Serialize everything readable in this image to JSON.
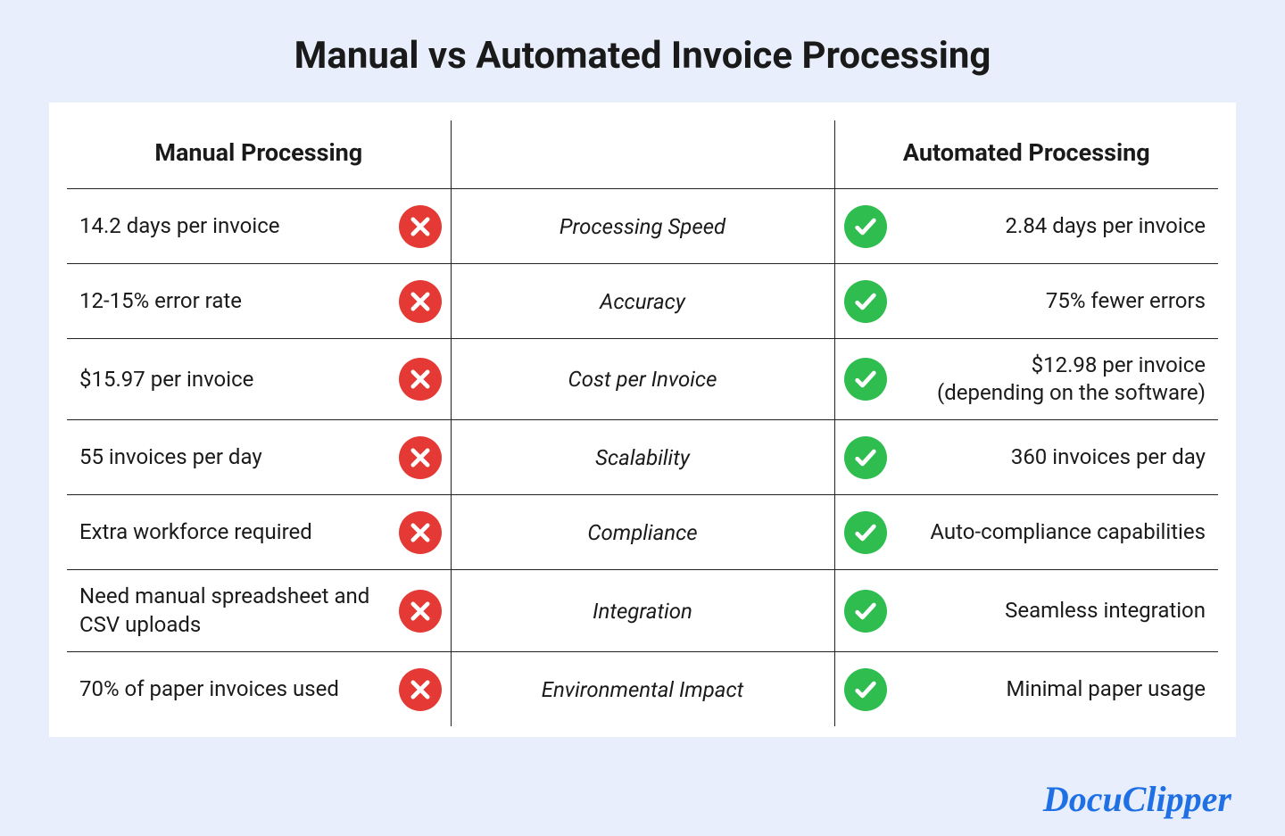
{
  "title": "Manual vs Automated Invoice Processing",
  "headers": {
    "left": "Manual Processing",
    "mid": "",
    "right": "Automated Processing"
  },
  "rows": [
    {
      "manual": "14.2 days per invoice",
      "criterion": "Processing Speed",
      "automated": "2.84 days per invoice"
    },
    {
      "manual": "12-15% error rate",
      "criterion": "Accuracy",
      "automated": "75% fewer errors"
    },
    {
      "manual": "$15.97 per invoice",
      "criterion": "Cost per Invoice",
      "automated": "$12.98 per invoice\n(depending on the software)"
    },
    {
      "manual": "55 invoices per day",
      "criterion": "Scalability",
      "automated": "360 invoices per day"
    },
    {
      "manual": "Extra workforce required",
      "criterion": "Compliance",
      "automated": "Auto-compliance capabilities"
    },
    {
      "manual": "Need manual spreadsheet and CSV uploads",
      "criterion": "Integration",
      "automated": "Seamless integration"
    },
    {
      "manual": "70% of paper invoices used",
      "criterion": "Environmental Impact",
      "automated": "Minimal paper usage"
    }
  ],
  "brand": "DocuClipper"
}
